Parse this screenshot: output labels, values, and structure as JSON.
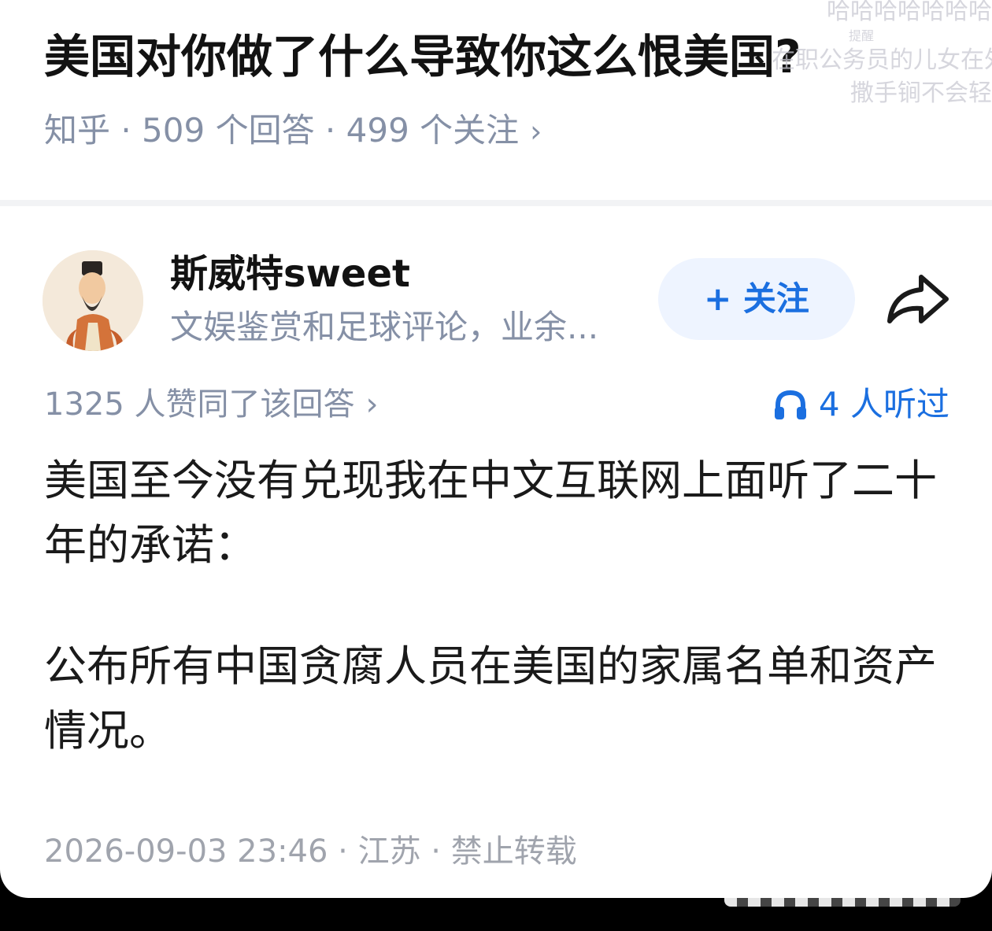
{
  "question": {
    "title": "美国对你做了什么导致你这么恨美国?",
    "meta": "知乎 · 509 个回答 · 499 个关注",
    "chevron": "›"
  },
  "watermark": {
    "line1": "哈哈哈哈哈哈哈",
    "line2": "提醒",
    "line3": "在职公务员的儿女在外",
    "line4": "撒手锏不会轻"
  },
  "author": {
    "name": "斯威特sweet",
    "bio": "文娱鉴赏和足球评论，业余...",
    "avatar_icon": "avatar-portrait-icon"
  },
  "follow_button": {
    "label": "+ 关注"
  },
  "share": {
    "icon": "share-arrow-icon"
  },
  "votes": {
    "text": "1325 人赞同了该回答",
    "chevron": "›"
  },
  "listen": {
    "text": "4 人听过",
    "icon": "headphones-icon"
  },
  "answer": {
    "paragraph1": "美国至今没有兑现我在中文互联网上面听了二十年的承诺：",
    "paragraph2": "公布所有中国贪腐人员在美国的家属名单和资产情况。"
  },
  "footer": {
    "meta": "2026-09-03 23:46 · 江苏 · 禁止转载"
  },
  "colors": {
    "accent_blue": "#1b6fe0",
    "meta_gray": "#8590a6",
    "follow_bg": "#eef4ff"
  }
}
